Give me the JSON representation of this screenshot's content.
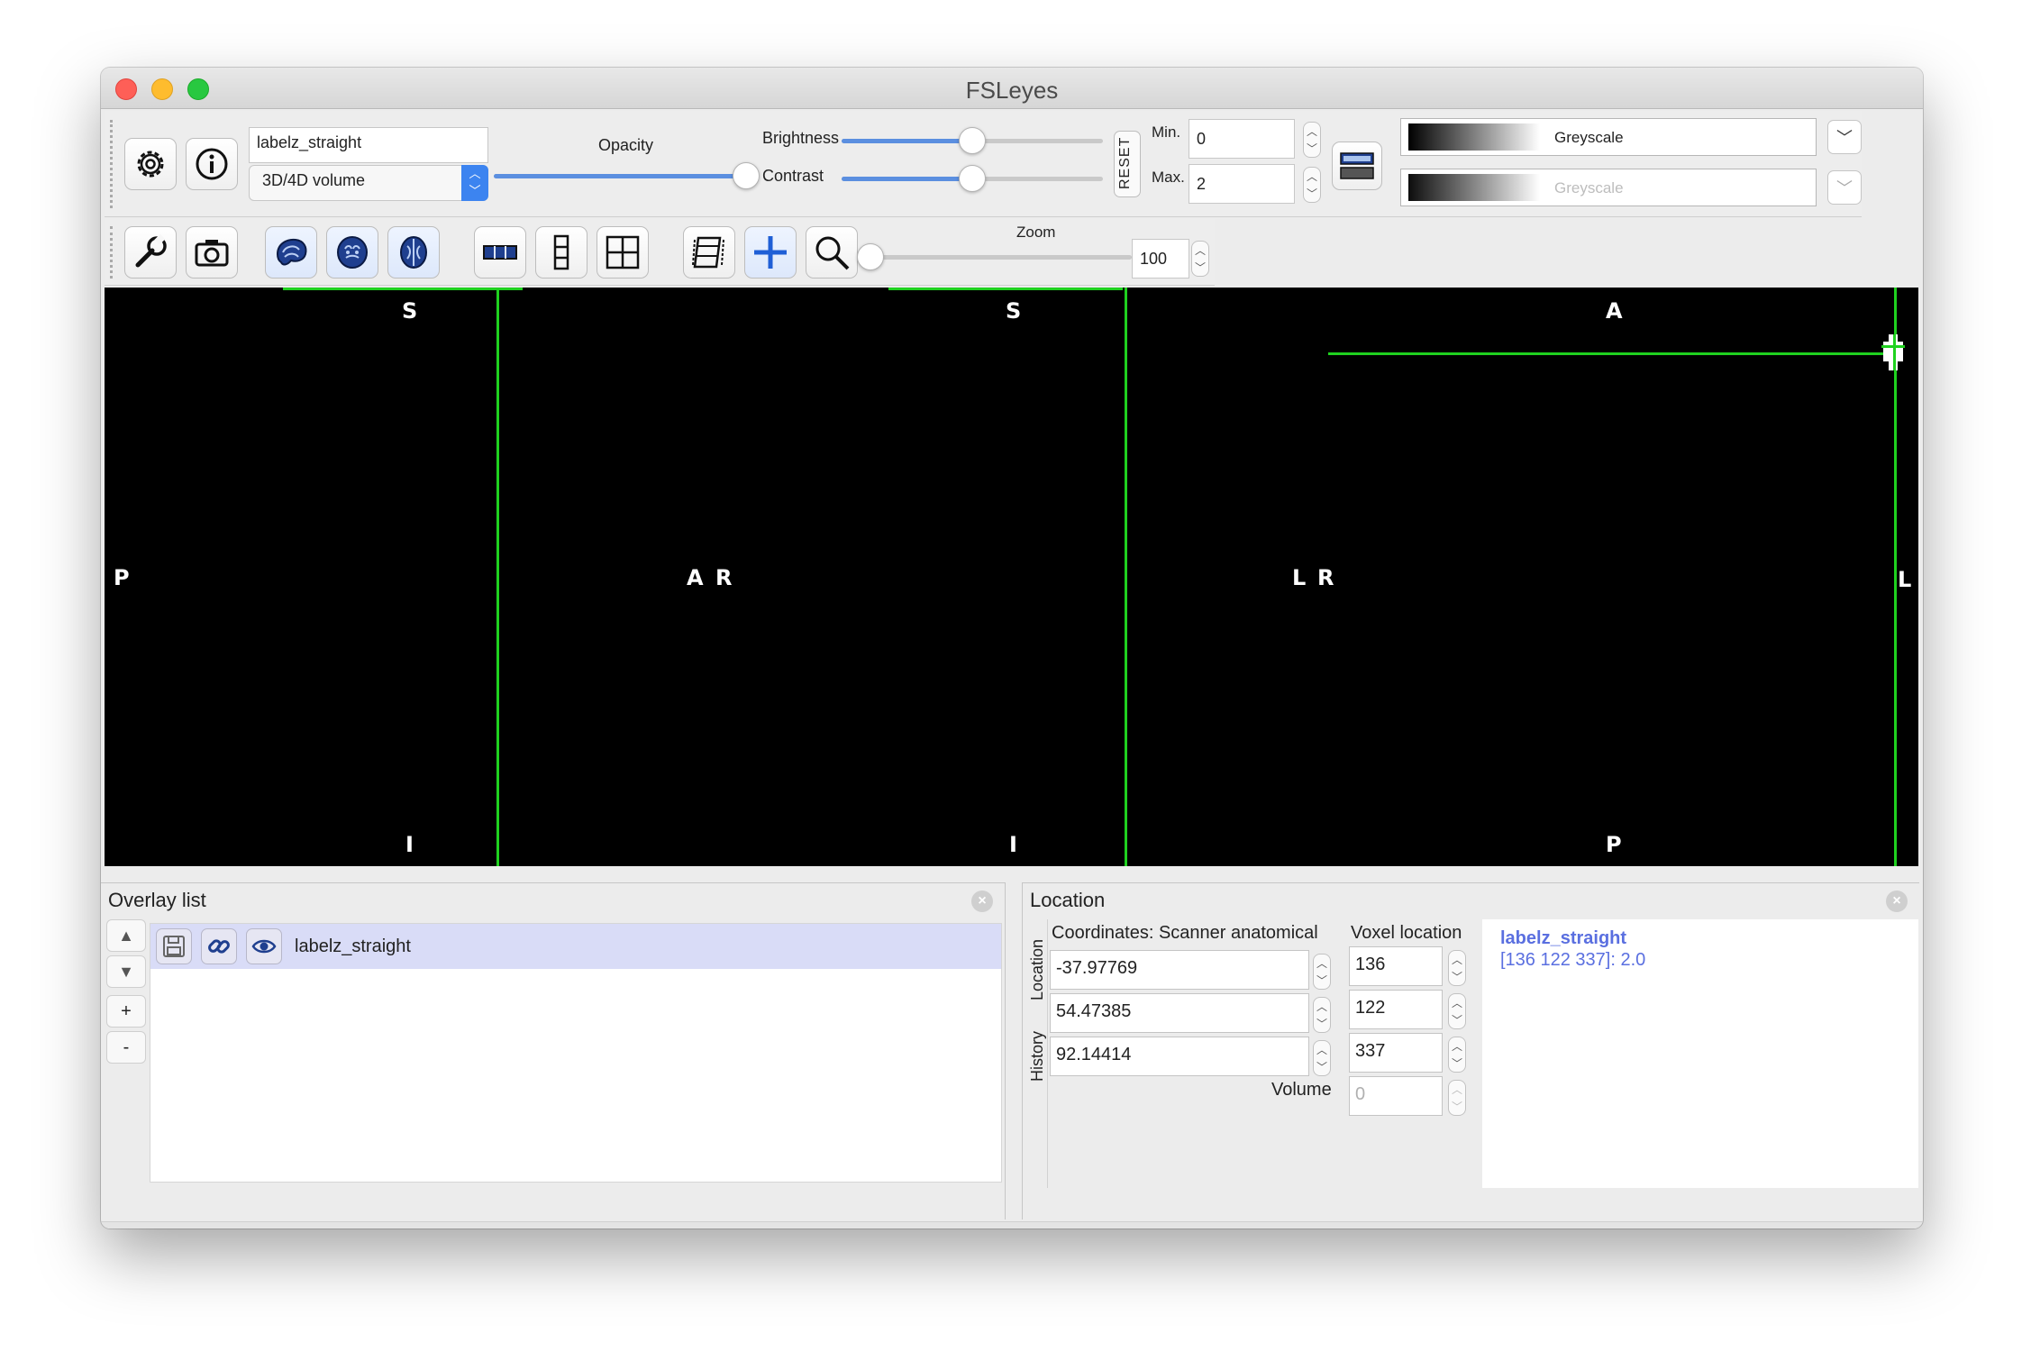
{
  "window": {
    "title": "FSLeyes"
  },
  "overlay_toolbar": {
    "overlay_name": "labelz_straight",
    "overlay_type": "3D/4D volume",
    "opacity_label": "Opacity",
    "brightness_label": "Brightness",
    "contrast_label": "Contrast",
    "reset_label": "RESET",
    "min_label": "Min.",
    "min_value": "0",
    "max_label": "Max.",
    "max_value": "2",
    "colormap_primary": "Greyscale",
    "colormap_secondary": "Greyscale",
    "opacity_level": 1.0,
    "brightness_level": 0.5,
    "contrast_level": 0.5
  },
  "ortho_toolbar": {
    "zoom_label": "Zoom",
    "zoom_value": "100",
    "zoom_level": 0.0
  },
  "canvas": {
    "sagittal": {
      "top": "S",
      "bottom": "I",
      "left": "P",
      "right": "A"
    },
    "coronal": {
      "top": "S",
      "bottom": "I",
      "left": "R",
      "right": "L"
    },
    "axial": {
      "top": "A",
      "bottom": "P",
      "left": "R",
      "right": "L"
    },
    "cursor_color": "#1fd11f"
  },
  "overlay_list": {
    "title": "Overlay list",
    "up": "▲",
    "down": "▼",
    "add": "+",
    "remove": "-",
    "items": [
      {
        "name": "labelz_straight",
        "selected": true
      }
    ]
  },
  "location": {
    "title": "Location",
    "tab_location": "Location",
    "tab_history": "History",
    "coords_header": "Coordinates: Scanner anatomical",
    "voxel_header": "Voxel location",
    "coords": [
      "-37.97769",
      "54.47385",
      "92.14414"
    ],
    "voxels": [
      "136",
      "122",
      "337"
    ],
    "volume_label": "Volume",
    "volume_value": "0",
    "info_name": "labelz_straight",
    "info_value": "[136 122 337]: 2.0",
    "info_color": "#5a6fe0"
  }
}
